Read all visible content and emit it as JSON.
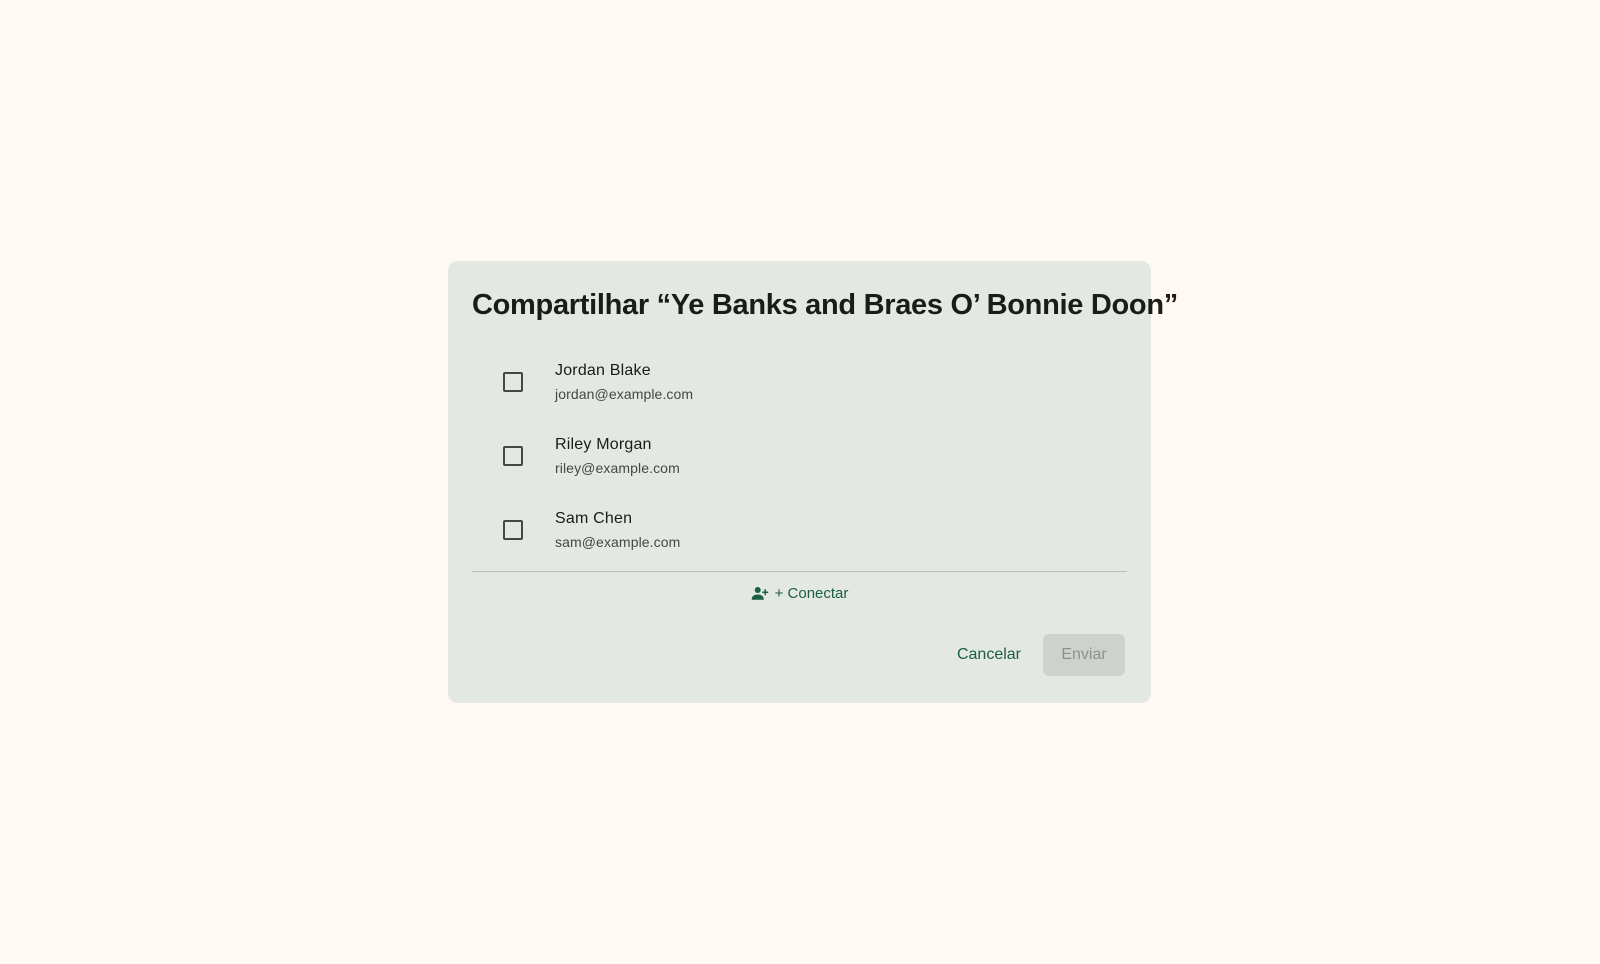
{
  "dialog": {
    "title": "Compartilhar “Ye Banks and Braes O’ Bonnie Doon”",
    "contacts": [
      {
        "name": "Jordan Blake",
        "email": "jordan@example.com",
        "checked": false
      },
      {
        "name": "Riley Morgan",
        "email": "riley@example.com",
        "checked": false
      },
      {
        "name": "Sam Chen",
        "email": "sam@example.com",
        "checked": false
      }
    ],
    "connect_label": "+ Conectar",
    "connect_icon": "person-add-icon",
    "cancel_label": "Cancelar",
    "send_label": "Enviar",
    "send_disabled": true
  },
  "colors": {
    "background": "#fff8f3",
    "dialog_surface": "#e3e8e2",
    "accent": "#1b5e42",
    "disabled_button": "#cdd2cc"
  }
}
